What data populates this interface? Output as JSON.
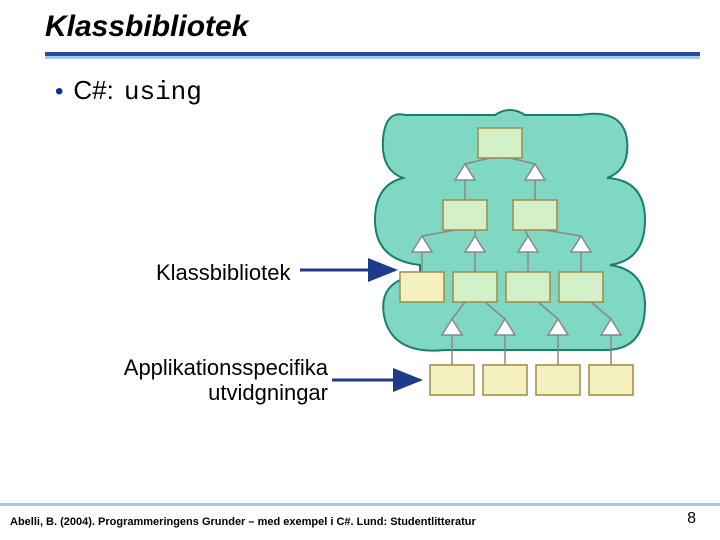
{
  "title": "Klassbibliotek",
  "bullet": {
    "prefix": "C#:",
    "code": "using"
  },
  "labels": {
    "klass": "Klassbibliotek",
    "app_line1": "Applikationsspecifika",
    "app_line2": "utvidgningar"
  },
  "footer": "Abelli, B. (2004). Programmeringens Grunder – med exempel i C#. Lund: Studentlitteratur",
  "page": "8",
  "colors": {
    "blob": "#7fd8c4",
    "blob_stroke": "#1a7f6a",
    "box_green": "#d4f0c8",
    "box_yellow": "#f5f0c0",
    "box_stroke": "#a08c40",
    "arrow": "#1e3a8a",
    "tri_fill": "#ffffff",
    "tri_stroke": "#888"
  }
}
